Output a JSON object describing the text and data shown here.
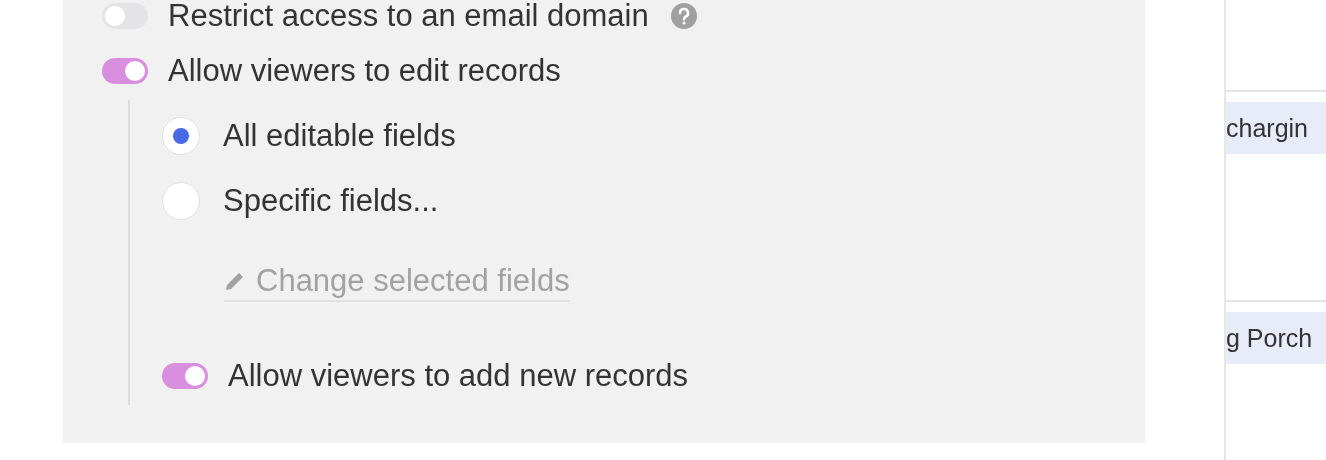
{
  "settings": [
    {
      "kind": "toggle",
      "label": "Restrict access to an email domain",
      "on": false,
      "help": true
    },
    {
      "kind": "toggle",
      "label": "Allow viewers to edit records",
      "on": true
    }
  ],
  "edit_options": {
    "choices": [
      {
        "label": "All editable fields",
        "selected": true
      },
      {
        "label": "Specific fields...",
        "selected": false
      }
    ],
    "change_link": {
      "label": "Change selected fields",
      "disabled": true
    },
    "add_records": {
      "label": "Allow viewers to add new records",
      "on": true
    }
  },
  "background_table": {
    "rows": [
      {
        "cell": "chargin"
      },
      {
        "cell": "g Porch"
      }
    ]
  }
}
